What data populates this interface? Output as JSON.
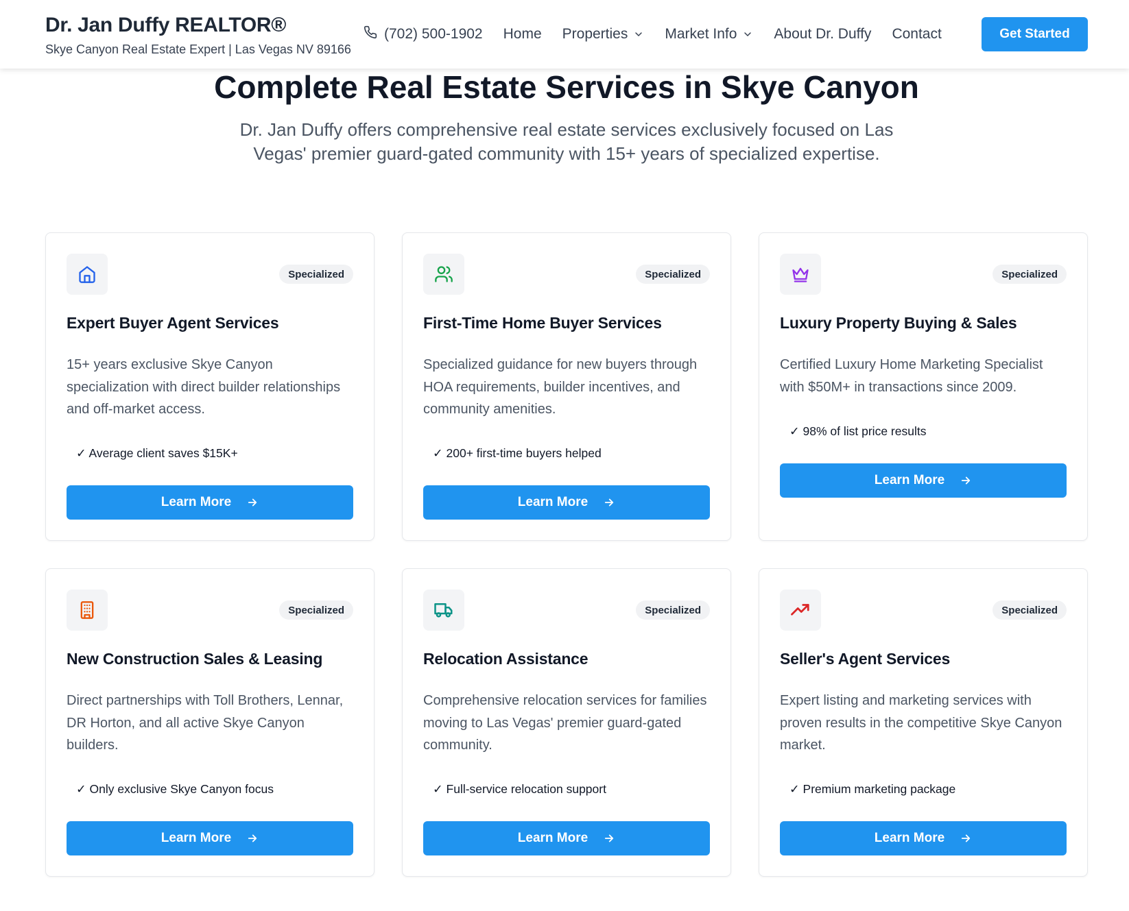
{
  "header": {
    "brand_title": "Dr. Jan Duffy REALTOR®",
    "brand_subtitle": "Skye Canyon Real Estate Expert | Las Vegas NV 89166",
    "phone": "(702) 500-1902",
    "nav": {
      "home": "Home",
      "properties": "Properties",
      "market_info": "Market Info",
      "about": "About Dr. Duffy",
      "contact": "Contact"
    },
    "cta_label": "Get Started"
  },
  "hero": {
    "title": "Complete Real Estate Services in Skye Canyon",
    "subtitle": "Dr. Jan Duffy offers comprehensive real estate services exclusively focused on Las Vegas' premier guard-gated community with 15+ years of specialized expertise."
  },
  "cards": [
    {
      "icon": "home-icon",
      "badge": "Specialized",
      "title": "Expert Buyer Agent Services",
      "description": "15+ years exclusive Skye Canyon specialization with direct builder relationships and off-market access.",
      "feature": "✓ Average client saves $15K+",
      "button": "Learn More"
    },
    {
      "icon": "users-icon",
      "badge": "Specialized",
      "title": "First-Time Home Buyer Services",
      "description": "Specialized guidance for new buyers through HOA requirements, builder incentives, and community amenities.",
      "feature": "✓ 200+ first-time buyers helped",
      "button": "Learn More"
    },
    {
      "icon": "crown-icon",
      "badge": "Specialized",
      "title": "Luxury Property Buying & Sales",
      "description": "Certified Luxury Home Marketing Specialist with $50M+ in transactions since 2009.",
      "feature": "✓ 98% of list price results",
      "button": "Learn More"
    },
    {
      "icon": "building-icon",
      "badge": "Specialized",
      "title": "New Construction Sales & Leasing",
      "description": "Direct partnerships with Toll Brothers, Lennar, DR Horton, and all active Skye Canyon builders.",
      "feature": "✓ Only exclusive Skye Canyon focus",
      "button": "Learn More"
    },
    {
      "icon": "truck-icon",
      "badge": "Specialized",
      "title": "Relocation Assistance",
      "description": "Comprehensive relocation services for families moving to Las Vegas' premier guard-gated community.",
      "feature": "✓ Full-service relocation support",
      "button": "Learn More"
    },
    {
      "icon": "trending-up-icon",
      "badge": "Specialized",
      "title": "Seller's Agent Services",
      "description": "Expert listing and marketing services with proven results in the competitive Skye Canyon market.",
      "feature": "✓ Premium marketing package",
      "button": "Learn More"
    }
  ],
  "colors": {
    "accent": "#2094ef",
    "home_icon": "#2563eb",
    "users_icon": "#16a34a",
    "crown_icon": "#9333ea",
    "building_icon": "#ea580c",
    "truck_icon": "#0d9488",
    "trending_icon": "#dc2626"
  }
}
